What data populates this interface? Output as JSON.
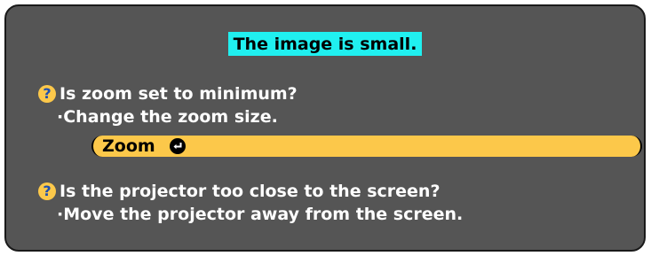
{
  "dialog": {
    "title": "The image is small.",
    "items": [
      {
        "question": "Is zoom set to minimum?",
        "answer": "·Change the zoom size.",
        "action": {
          "label": "Zoom",
          "icon": "enter-icon"
        }
      },
      {
        "question": "Is the projector too close to the screen?",
        "answer": "·Move the projector away from the screen."
      }
    ]
  },
  "colors": {
    "panel_bg": "#555555",
    "title_highlight": "#20f0f0",
    "zoom_bar": "#fcc84a",
    "question_icon": "#fcc84a",
    "question_mark": "#1e4fb0",
    "text": "#ffffff"
  },
  "icons": {
    "question": "question-circle-icon",
    "enter": "enter-icon"
  }
}
